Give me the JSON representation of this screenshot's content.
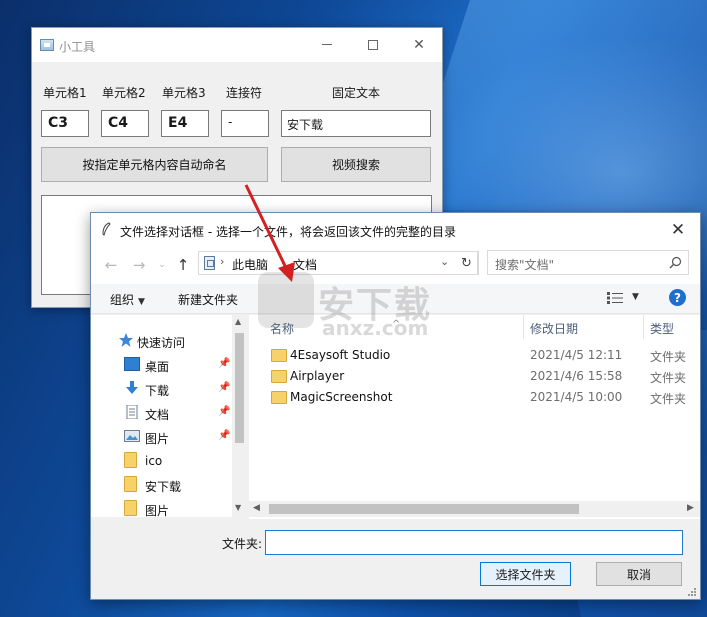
{
  "tool_window": {
    "title": "小工具",
    "labels": {
      "cell1": "单元格1",
      "cell2": "单元格2",
      "cell3": "单元格3",
      "connector": "连接符",
      "fixed_text": "固定文本"
    },
    "values": {
      "cell1": "C3",
      "cell2": "C4",
      "cell3": "E4",
      "connector": "-",
      "fixed_text": "安下载"
    },
    "buttons": {
      "auto_rename": "按指定单元格内容自动命名",
      "video_search": "视频搜索"
    }
  },
  "file_dialog": {
    "title": "文件选择对话框 - 选择一个文件，将会返回该文件的完整的目录",
    "address": {
      "segments": [
        "此电脑",
        "文档"
      ]
    },
    "search": {
      "placeholder": "搜索\"文档\""
    },
    "toolbar": {
      "organize": "组织",
      "new_folder": "新建文件夹"
    },
    "nav": {
      "quick_access": "快速访问",
      "items": [
        {
          "label": "桌面",
          "icon": "desktop-icon",
          "pinned": true
        },
        {
          "label": "下载",
          "icon": "download-icon",
          "pinned": true
        },
        {
          "label": "文档",
          "icon": "document-icon",
          "pinned": true
        },
        {
          "label": "图片",
          "icon": "pictures-icon",
          "pinned": true
        },
        {
          "label": "ico",
          "icon": "folder-icon",
          "pinned": false
        },
        {
          "label": "安下载",
          "icon": "folder-icon",
          "pinned": false
        },
        {
          "label": "图片",
          "icon": "folder-icon",
          "pinned": false
        }
      ]
    },
    "columns": {
      "name": "名称",
      "date": "修改日期",
      "type": "类型"
    },
    "files": [
      {
        "name": "4Esaysoft Studio",
        "date": "2021/4/5 12:11",
        "type": "文件夹"
      },
      {
        "name": "Airplayer",
        "date": "2021/4/6 15:58",
        "type": "文件夹"
      },
      {
        "name": "MagicScreenshot",
        "date": "2021/4/5 10:00",
        "type": "文件夹"
      }
    ],
    "folder_label": "文件夹:",
    "folder_value": "",
    "buttons": {
      "ok": "选择文件夹",
      "cancel": "取消"
    }
  },
  "watermark": {
    "text": "安下载",
    "sub": "anxz.com"
  },
  "colors": {
    "arrow": "#d32020",
    "accent": "#0078d7",
    "folder": "#f7d26a"
  }
}
